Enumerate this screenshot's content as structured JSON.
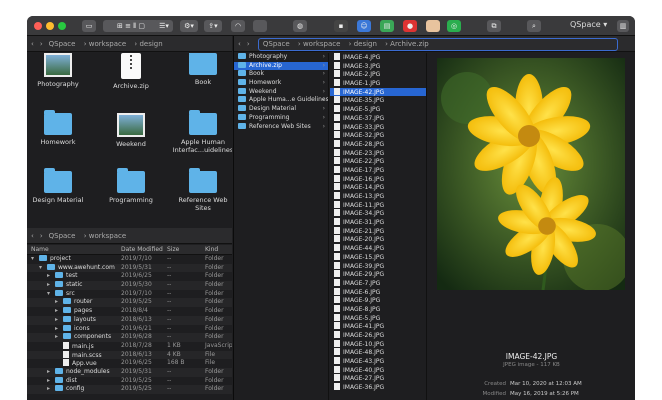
{
  "app": "QSpace",
  "toolbar": {
    "qspace": "QSpace"
  },
  "left_top": {
    "path": [
      "QSpace",
      "workspace",
      "design"
    ],
    "tiles": [
      {
        "label": "Photography",
        "kind": "photo"
      },
      {
        "label": "Archive.zip",
        "kind": "zip"
      },
      {
        "label": "Book",
        "kind": "folder"
      },
      {
        "label": "Homework",
        "kind": "folder"
      },
      {
        "label": "Weekend",
        "kind": "photo"
      },
      {
        "label": "Apple Human Interfac...uidelines",
        "kind": "folder"
      },
      {
        "label": "Design Material",
        "kind": "folder"
      },
      {
        "label": "Programming",
        "kind": "folder"
      },
      {
        "label": "Reference Web Sites",
        "kind": "folder"
      }
    ]
  },
  "left_bottom": {
    "path": [
      "QSpace",
      "workspace"
    ],
    "headers": {
      "name": "Name",
      "date": "Date Modified",
      "size": "Size",
      "kind": "Kind"
    },
    "rows": [
      {
        "name": "project",
        "date": "2019/7/10",
        "size": "--",
        "kind": "Folder",
        "depth": 0,
        "type": "folder",
        "open": true
      },
      {
        "name": "www.awehunt.com",
        "date": "2019/5/31",
        "size": "--",
        "kind": "Folder",
        "depth": 1,
        "type": "folder",
        "open": true
      },
      {
        "name": "test",
        "date": "2019/6/25",
        "size": "--",
        "kind": "Folder",
        "depth": 2,
        "type": "folder",
        "open": false
      },
      {
        "name": "static",
        "date": "2019/5/30",
        "size": "--",
        "kind": "Folder",
        "depth": 2,
        "type": "folder",
        "open": false
      },
      {
        "name": "src",
        "date": "2019/7/10",
        "size": "--",
        "kind": "Folder",
        "depth": 2,
        "type": "folder",
        "open": true
      },
      {
        "name": "router",
        "date": "2019/5/25",
        "size": "--",
        "kind": "Folder",
        "depth": 3,
        "type": "folder",
        "open": false
      },
      {
        "name": "pages",
        "date": "2018/8/4",
        "size": "--",
        "kind": "Folder",
        "depth": 3,
        "type": "folder",
        "open": false
      },
      {
        "name": "layouts",
        "date": "2018/6/13",
        "size": "--",
        "kind": "Folder",
        "depth": 3,
        "type": "folder",
        "open": false
      },
      {
        "name": "icons",
        "date": "2019/6/21",
        "size": "--",
        "kind": "Folder",
        "depth": 3,
        "type": "folder",
        "open": false
      },
      {
        "name": "components",
        "date": "2019/6/28",
        "size": "--",
        "kind": "Folder",
        "depth": 3,
        "type": "folder",
        "open": false
      },
      {
        "name": "main.js",
        "date": "2018/7/28",
        "size": "1 KB",
        "kind": "JavaScript",
        "depth": 3,
        "type": "file",
        "open": false
      },
      {
        "name": "main.scss",
        "date": "2018/6/13",
        "size": "4 KB",
        "kind": "File",
        "depth": 3,
        "type": "file",
        "open": false
      },
      {
        "name": "App.vue",
        "date": "2019/6/25",
        "size": "168 B",
        "kind": "File",
        "depth": 3,
        "type": "file",
        "open": false
      },
      {
        "name": "node_modules",
        "date": "2019/5/31",
        "size": "--",
        "kind": "Folder",
        "depth": 2,
        "type": "folder",
        "open": false
      },
      {
        "name": "dist",
        "date": "2019/5/25",
        "size": "--",
        "kind": "Folder",
        "depth": 2,
        "type": "folder",
        "open": false
      },
      {
        "name": "config",
        "date": "2019/5/25",
        "size": "--",
        "kind": "Folder",
        "depth": 2,
        "type": "folder",
        "open": false
      }
    ]
  },
  "right": {
    "path": [
      "QSpace",
      "workspace",
      "design",
      "Archive.zip"
    ],
    "col1": [
      "Photography",
      "Archive.zip",
      "Book",
      "Homework",
      "Weekend",
      "Apple Huma...e Guidelines",
      "Design Material",
      "Programming",
      "Reference Web Sites"
    ],
    "col1_selected": 1,
    "col2": [
      "IMAGE-4.JPG",
      "IMAGE-3.JPG",
      "IMAGE-2.JPG",
      "IMAGE-1.JPG",
      "IMAGE-42.JPG",
      "IMAGE-35.JPG",
      "IMAGE-5.JPG",
      "IMAGE-37.JPG",
      "IMAGE-33.JPG",
      "IMAGE-32.JPG",
      "IMAGE-28.JPG",
      "IMAGE-23.JPG",
      "IMAGE-22.JPG",
      "IMAGE-17.JPG",
      "IMAGE-16.JPG",
      "IMAGE-14.JPG",
      "IMAGE-13.JPG",
      "IMAGE-11.JPG",
      "IMAGE-34.JPG",
      "IMAGE-31.JPG",
      "IMAGE-21.JPG",
      "IMAGE-20.JPG",
      "IMAGE-44.JPG",
      "IMAGE-15.JPG",
      "IMAGE-39.JPG",
      "IMAGE-29.JPG",
      "IMAGE-7.JPG",
      "IMAGE-6.JPG",
      "IMAGE-9.JPG",
      "IMAGE-8.JPG",
      "IMAGE-5.JPG",
      "IMAGE-41.JPG",
      "IMAGE-26.JPG",
      "IMAGE-10.JPG",
      "IMAGE-48.JPG",
      "IMAGE-43.JPG",
      "IMAGE-40.JPG",
      "IMAGE-27.JPG",
      "IMAGE-36.JPG"
    ],
    "col2_selected": 4,
    "preview": {
      "name": "IMAGE-42.JPG",
      "info": "JPEG image - 117 KB",
      "created_label": "Created",
      "created": "Mar 10, 2020 at 12:03 AM",
      "modified_label": "Modified",
      "modified": "May 16, 2019 at 5:26 PM"
    }
  }
}
